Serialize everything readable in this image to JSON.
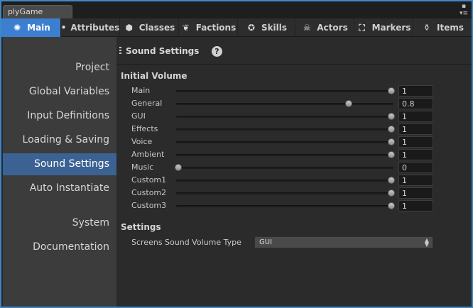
{
  "window": {
    "title": "plyGame"
  },
  "toolbar": {
    "tabs": [
      {
        "label": "Main",
        "icon": "gear-icon"
      },
      {
        "label": "Attributes",
        "icon": "bullet-icon"
      },
      {
        "label": "Classes",
        "icon": "class-icon"
      },
      {
        "label": "Factions",
        "icon": "wings-icon"
      },
      {
        "label": "Skills",
        "icon": "skill-icon"
      },
      {
        "label": "Actors",
        "icon": "skull-icon"
      },
      {
        "label": "Markers",
        "icon": "marker-icon"
      },
      {
        "label": "Items",
        "icon": "potion-icon"
      }
    ],
    "active": "Main"
  },
  "sidebar": {
    "items": [
      "Project",
      "Global Variables",
      "Input Definitions",
      "Loading & Saving",
      "Sound Settings",
      "Auto Instantiate",
      "System",
      "Documentation"
    ],
    "active": "Sound Settings"
  },
  "main": {
    "section_title": "Sound Settings",
    "initial_volume_heading": "Initial Volume",
    "sliders": [
      {
        "label": "Main",
        "value": 1,
        "display": "1"
      },
      {
        "label": "General",
        "value": 0.8,
        "display": "0.8"
      },
      {
        "label": "GUI",
        "value": 1,
        "display": "1"
      },
      {
        "label": "Effects",
        "value": 1,
        "display": "1"
      },
      {
        "label": "Voice",
        "value": 1,
        "display": "1"
      },
      {
        "label": "Ambient",
        "value": 1,
        "display": "1"
      },
      {
        "label": "Music",
        "value": 0,
        "display": "0"
      },
      {
        "label": "Custom1",
        "value": 1,
        "display": "1"
      },
      {
        "label": "Custom2",
        "value": 1,
        "display": "1"
      },
      {
        "label": "Custom3",
        "value": 1,
        "display": "1"
      }
    ],
    "settings_heading": "Settings",
    "screens_volume_label": "Screens Sound Volume Type",
    "screens_volume_value": "GUI"
  },
  "colors": {
    "accent": "#3c7fd0",
    "sidebar_active": "#3c6293",
    "window_border": "#3f87c8"
  }
}
